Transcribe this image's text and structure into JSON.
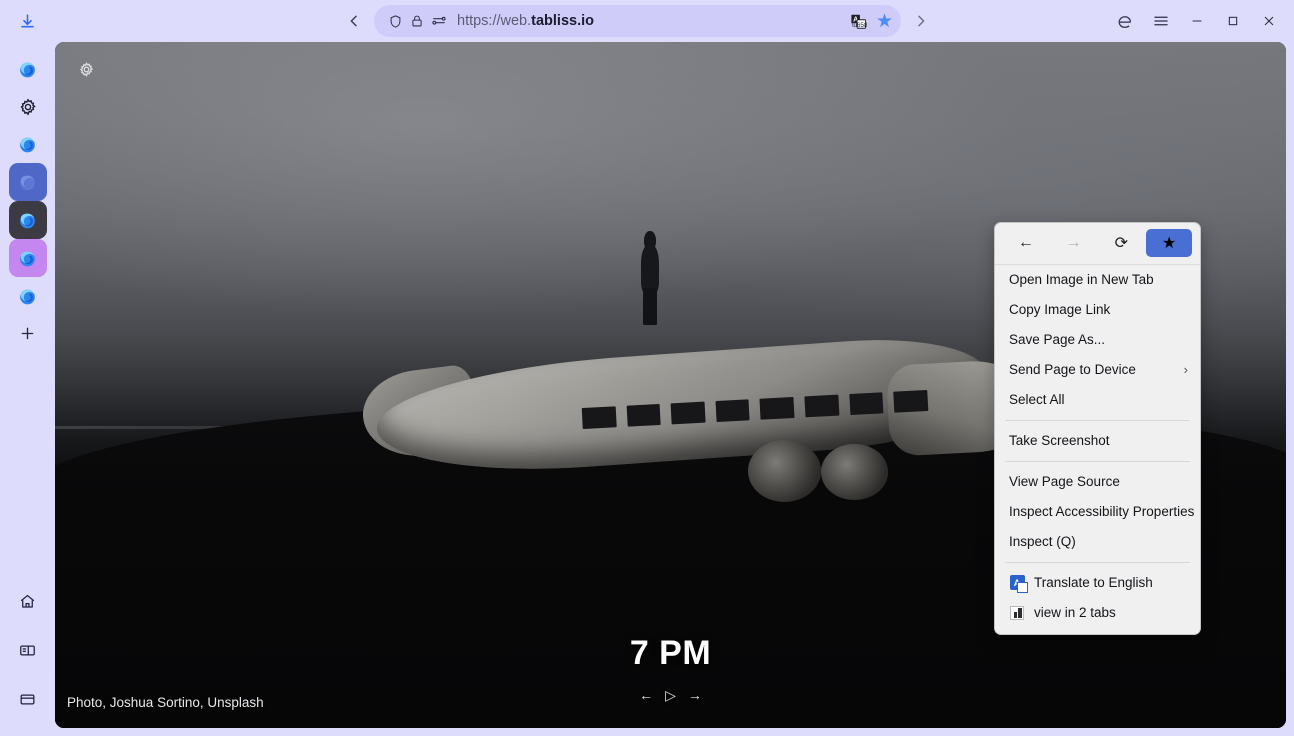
{
  "browser": {
    "downloads_icon": "download-icon",
    "back_label": "‹",
    "forward_label": "›",
    "url_prefix": "https://web.",
    "url_domain": "tabliss.io",
    "url_full": "https://web.tabliss.io",
    "shield_icon": "shield-icon",
    "lock_icon": "lock-icon",
    "permissions_icon": "permissions-icon",
    "translate_icon": "translate-icon",
    "bookmark_star_icon": "star-icon",
    "extension_label": "e",
    "menu_label": "≡",
    "minimize_label": "─",
    "maximize_label": "□",
    "close_label": "✕"
  },
  "sidebar": {
    "items": [
      {
        "name": "firefox-profile-1",
        "style": "plain",
        "icon": "firefox-icon"
      },
      {
        "name": "settings",
        "style": "plain",
        "icon": "gear-icon"
      },
      {
        "name": "firefox-profile-2",
        "style": "plain",
        "icon": "firefox-icon"
      },
      {
        "name": "firefox-profile-3",
        "style": "sel-blue",
        "icon": "firefox-icon"
      },
      {
        "name": "firefox-profile-4",
        "style": "sel-dark",
        "icon": "firefox-icon"
      },
      {
        "name": "firefox-profile-5",
        "style": "sel-purple",
        "icon": "firefox-icon"
      },
      {
        "name": "firefox-profile-6",
        "style": "plain",
        "icon": "firefox-icon"
      },
      {
        "name": "add-profile",
        "style": "plain",
        "icon": "plus-icon"
      }
    ],
    "bottom": [
      {
        "name": "home",
        "icon": "home-icon"
      },
      {
        "name": "panels",
        "icon": "sidebar-panel-icon"
      },
      {
        "name": "workspaces",
        "icon": "workspace-icon"
      }
    ]
  },
  "page": {
    "settings_icon": "gear-icon",
    "clock": "7 PM",
    "credit": "Photo, Joshua Sortino, Unsplash",
    "slideshow": {
      "prev": "←",
      "play": "▷",
      "next": "→"
    }
  },
  "context_menu": {
    "nav": [
      {
        "name": "back",
        "label": "←",
        "state": "enabled"
      },
      {
        "name": "forward",
        "label": "→",
        "state": "disabled"
      },
      {
        "name": "reload",
        "label": "⟳",
        "state": "enabled"
      },
      {
        "name": "bookmark",
        "label": "★",
        "state": "active"
      }
    ],
    "items": [
      {
        "label": "Open Image in New Tab",
        "accel": "I",
        "type": "item"
      },
      {
        "label": "Copy Image Link",
        "accel": "o",
        "type": "item"
      },
      {
        "label": "Save Page As...",
        "accel": "P",
        "type": "item"
      },
      {
        "label": "Send Page to Device",
        "accel": "n",
        "type": "submenu",
        "arrow": "›"
      },
      {
        "label": "Select All",
        "accel": "A",
        "type": "item"
      },
      {
        "type": "separator"
      },
      {
        "label": "Take Screenshot",
        "accel": "T",
        "type": "item"
      },
      {
        "type": "separator"
      },
      {
        "label": "View Page Source",
        "accel": "V",
        "type": "item"
      },
      {
        "label": "Inspect Accessibility Properties",
        "accel": "",
        "type": "item"
      },
      {
        "label": "Inspect (Q)",
        "accel": "",
        "type": "item"
      },
      {
        "type": "separator"
      },
      {
        "label": "Translate to English",
        "accel": "",
        "type": "item",
        "icon": "translate-icon"
      },
      {
        "label": "view in 2 tabs",
        "accel": "",
        "type": "item",
        "icon": "bar-chart-icon"
      }
    ]
  },
  "colors": {
    "chrome_bg": "#dedcfc",
    "urlbar_bg": "#cfccfa",
    "accent_blue": "#4a8df6",
    "menu_bg": "#f0f0f0",
    "profile_blue": "#4f68c8",
    "profile_dark": "#3c3b44",
    "profile_purple": "#c487ef"
  }
}
